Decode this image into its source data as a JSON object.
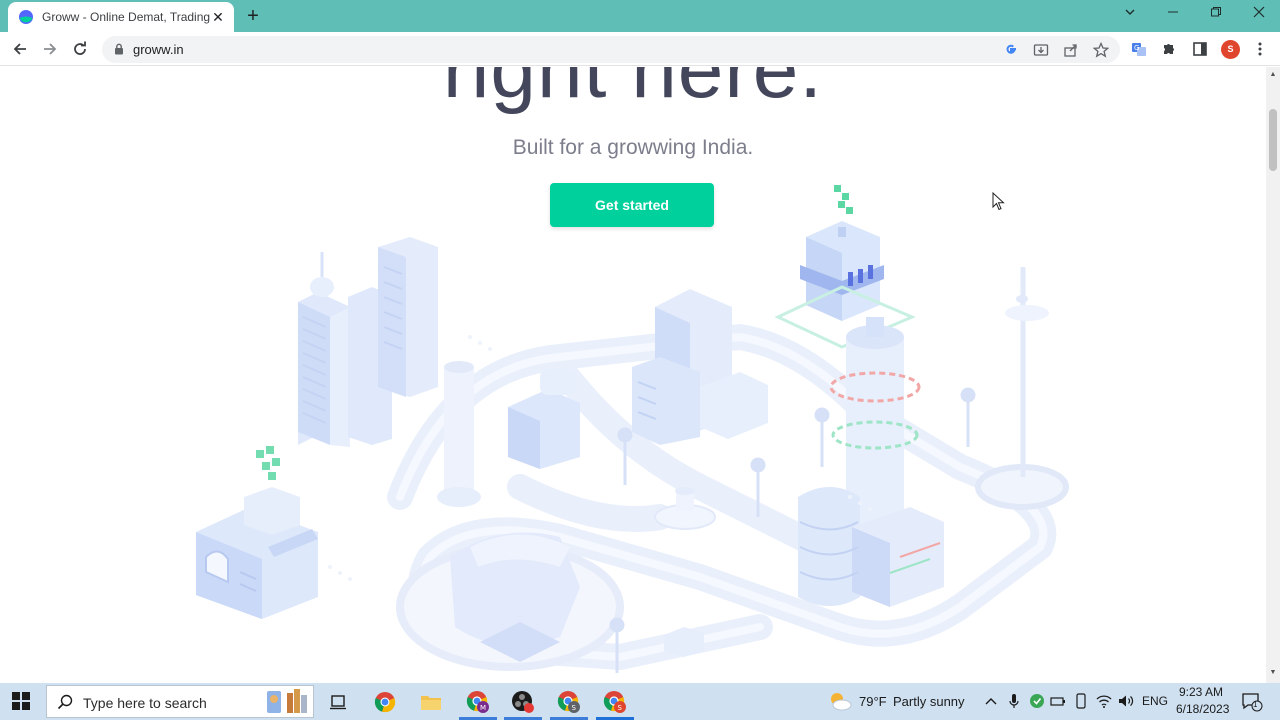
{
  "browser": {
    "tab_title": "Groww - Online Demat, Trading a",
    "url": "groww.in",
    "profile_initial": "S"
  },
  "page": {
    "hero_title": "right here.",
    "subtitle": "Built for a growwing India.",
    "cta_label": "Get started",
    "brand_color": "#00d09c"
  },
  "taskbar": {
    "search_placeholder": "Type here to search",
    "weather_temp": "79°F",
    "weather_desc": "Partly sunny",
    "language": "ENG",
    "time": "9:23 AM",
    "date": "6/18/2023",
    "notification_count": "1"
  },
  "icons": [
    "back-icon",
    "forward-icon",
    "reload-icon",
    "lock-icon",
    "google-lens-icon",
    "install-icon",
    "share-icon",
    "bookmark-star-icon",
    "translate-icon",
    "extensions-icon",
    "side-panel-icon",
    "menu-icon",
    "windows-start-icon",
    "task-view-icon",
    "chrome-icon",
    "file-explorer-icon",
    "weather-icon"
  ]
}
